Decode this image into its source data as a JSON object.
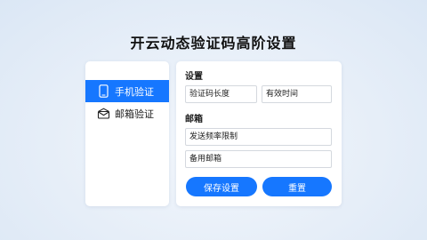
{
  "page": {
    "title": "开云动态验证码高阶设置"
  },
  "sidebar": {
    "items": [
      {
        "label": "手机验证",
        "icon": "phone-icon",
        "active": true
      },
      {
        "label": "邮箱验证",
        "icon": "mail-icon",
        "active": false
      }
    ]
  },
  "settings": {
    "section_title": "设置",
    "code_length_placeholder": "验证码长度",
    "validity_placeholder": "有效时间"
  },
  "mailbox": {
    "section_title": "邮箱",
    "rate_limit_placeholder": "发送频率限制",
    "backup_email_placeholder": "备用邮箱"
  },
  "actions": {
    "save_label": "保存设置",
    "reset_label": "重置"
  },
  "colors": {
    "accent": "#1677ff",
    "background": "#e6eef8",
    "card": "#ffffff",
    "field_border": "#d4d8de"
  }
}
